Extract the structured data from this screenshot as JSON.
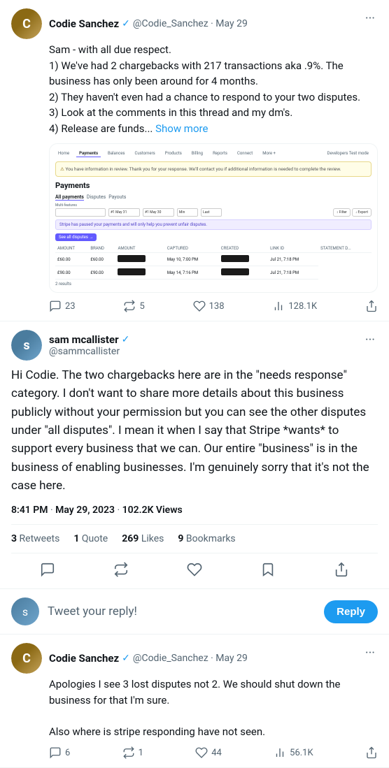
{
  "tweet1": {
    "avatar_initial": "C",
    "display_name": "Codie Sanchez",
    "handle": "@Codie_Sanchez",
    "date": "May 29",
    "text_lines": [
      "Sam - with all due respect.",
      "1) We've had 2 chargebacks with 217 transactions aka .9%. The business has only been around for 4 months.",
      "2) They haven't even had a chance to respond to your two disputes.",
      "3) Look at the comments in this thread and my dm's.",
      "4) Release are funds..."
    ],
    "show_more": "Show more",
    "reply_count": "23",
    "retweet_count": "5",
    "like_count": "138",
    "views": "128.1K"
  },
  "main_tweet": {
    "avatar_initial": "S",
    "display_name": "sam mcallister",
    "handle": "@sammcallister",
    "more_icon": "···",
    "text": "Hi Codie. The two chargebacks here are in the \"needs response\" category. I don't want to share more details about this business publicly without your permission but you can see the other disputes under \"all disputes\". I mean it when I say that Stripe *wants* to support every business that we can. Our entire \"business\" is in the business of enabling businesses. I'm genuinely sorry that it's not the case here.",
    "time": "8:41 PM",
    "date": "May 29, 2023",
    "views": "102.2K Views",
    "retweets_count": "3",
    "retweets_label": "Retweets",
    "quote_count": "1",
    "quote_label": "Quote",
    "likes_count": "269",
    "likes_label": "Likes",
    "bookmarks_count": "9",
    "bookmarks_label": "Bookmarks"
  },
  "reply_box": {
    "placeholder": "Tweet your reply!",
    "button_label": "Reply",
    "avatar_initial": "S"
  },
  "tweet2": {
    "avatar_initial": "C",
    "display_name": "Codie Sanchez",
    "handle": "@Codie_Sanchez",
    "date": "May 29",
    "text1": "Apologies I see 3 lost disputes not 2. We should shut down the business for that I'm sure.",
    "text2": "Also where is stripe responding have not seen.",
    "reply_count": "6",
    "retweet_count": "1",
    "like_count": "44",
    "views": "56.1K"
  },
  "screenshot": {
    "nav_items": [
      "Home",
      "Payments",
      "Balances",
      "Customers",
      "Products",
      "Billing",
      "Reports",
      "Connect",
      "More"
    ],
    "active_nav": "Payments",
    "alert_text": "You have information in review. Thank you for your response. We'll contact you if additional information is needed to complete the review.",
    "title": "Payments",
    "table_headers": [
      "AMOUNT",
      "BRAND",
      "AMOUNT",
      "CAPTURED",
      "CREATED",
      "LINK ID",
      "STATEMENT D"
    ],
    "rows": [
      {
        "amount": "£60.00",
        "brand": "£60.00",
        "captured": "",
        "created": "May 10, 7:00 PM",
        "link": "",
        "stmt": ""
      },
      {
        "amount": "£90.00",
        "brand": "£90.00",
        "captured": "",
        "created": "Jul 21, 7:18 PM",
        "link": "",
        "stmt": ""
      }
    ]
  },
  "icons": {
    "comment": "💬",
    "retweet": "🔁",
    "heart": "🤍",
    "chart": "📊",
    "share": "⬆",
    "bookmark": "🔖",
    "more": "···",
    "verified": "✓"
  }
}
